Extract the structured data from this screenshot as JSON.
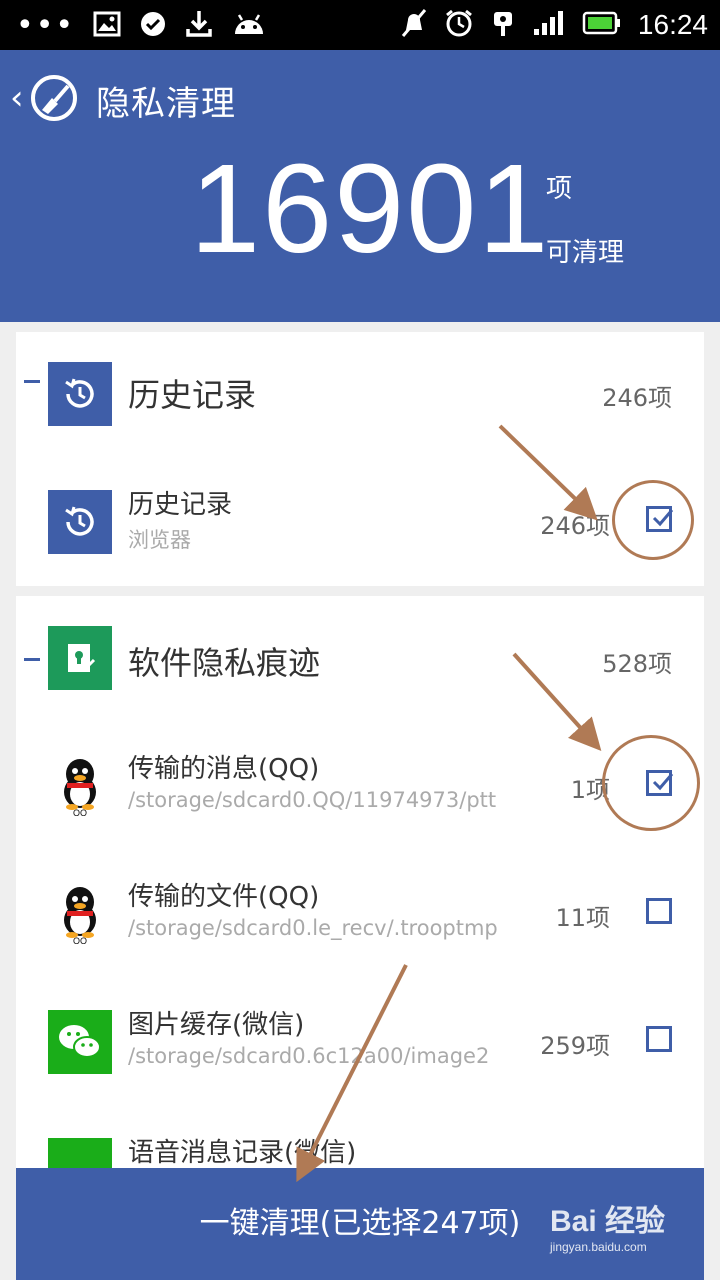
{
  "status_bar": {
    "dots": "•••",
    "time": "16:24"
  },
  "header": {
    "title": "隐私清理",
    "total_count": "16901",
    "unit_top": "项",
    "unit_bottom": "可清理"
  },
  "groups": [
    {
      "title": "历史记录",
      "count": "246项",
      "items": [
        {
          "title": "历史记录",
          "subtitle": "浏览器",
          "count": "246项",
          "checked": true
        }
      ]
    },
    {
      "title": "软件隐私痕迹",
      "count": "528项",
      "items": [
        {
          "title": "传输的消息(QQ)",
          "subtitle": "/storage/sdcard0.QQ/11974973/ptt",
          "count": "1项",
          "checked": true,
          "icon_label": "QQ"
        },
        {
          "title": "传输的文件(QQ)",
          "subtitle": "/storage/sdcard0.le_recv/.trooptmp",
          "count": "11项",
          "checked": false,
          "icon_label": "QQ"
        },
        {
          "title": "图片缓存(微信)",
          "subtitle": "/storage/sdcard0.6c12a00/image2",
          "count": "259项",
          "checked": false
        },
        {
          "title": "语音消息记录(微信)",
          "subtitle": "",
          "count": "",
          "checked": false
        }
      ]
    }
  ],
  "bottom_button": {
    "label": "一键清理(已选择247项)"
  },
  "watermark": {
    "brand": "Bai 经验",
    "url": "jingyan.baidu.com"
  },
  "colors": {
    "primary": "#3f5ea8",
    "annotation": "#b07a55",
    "green": "#1aad19"
  }
}
